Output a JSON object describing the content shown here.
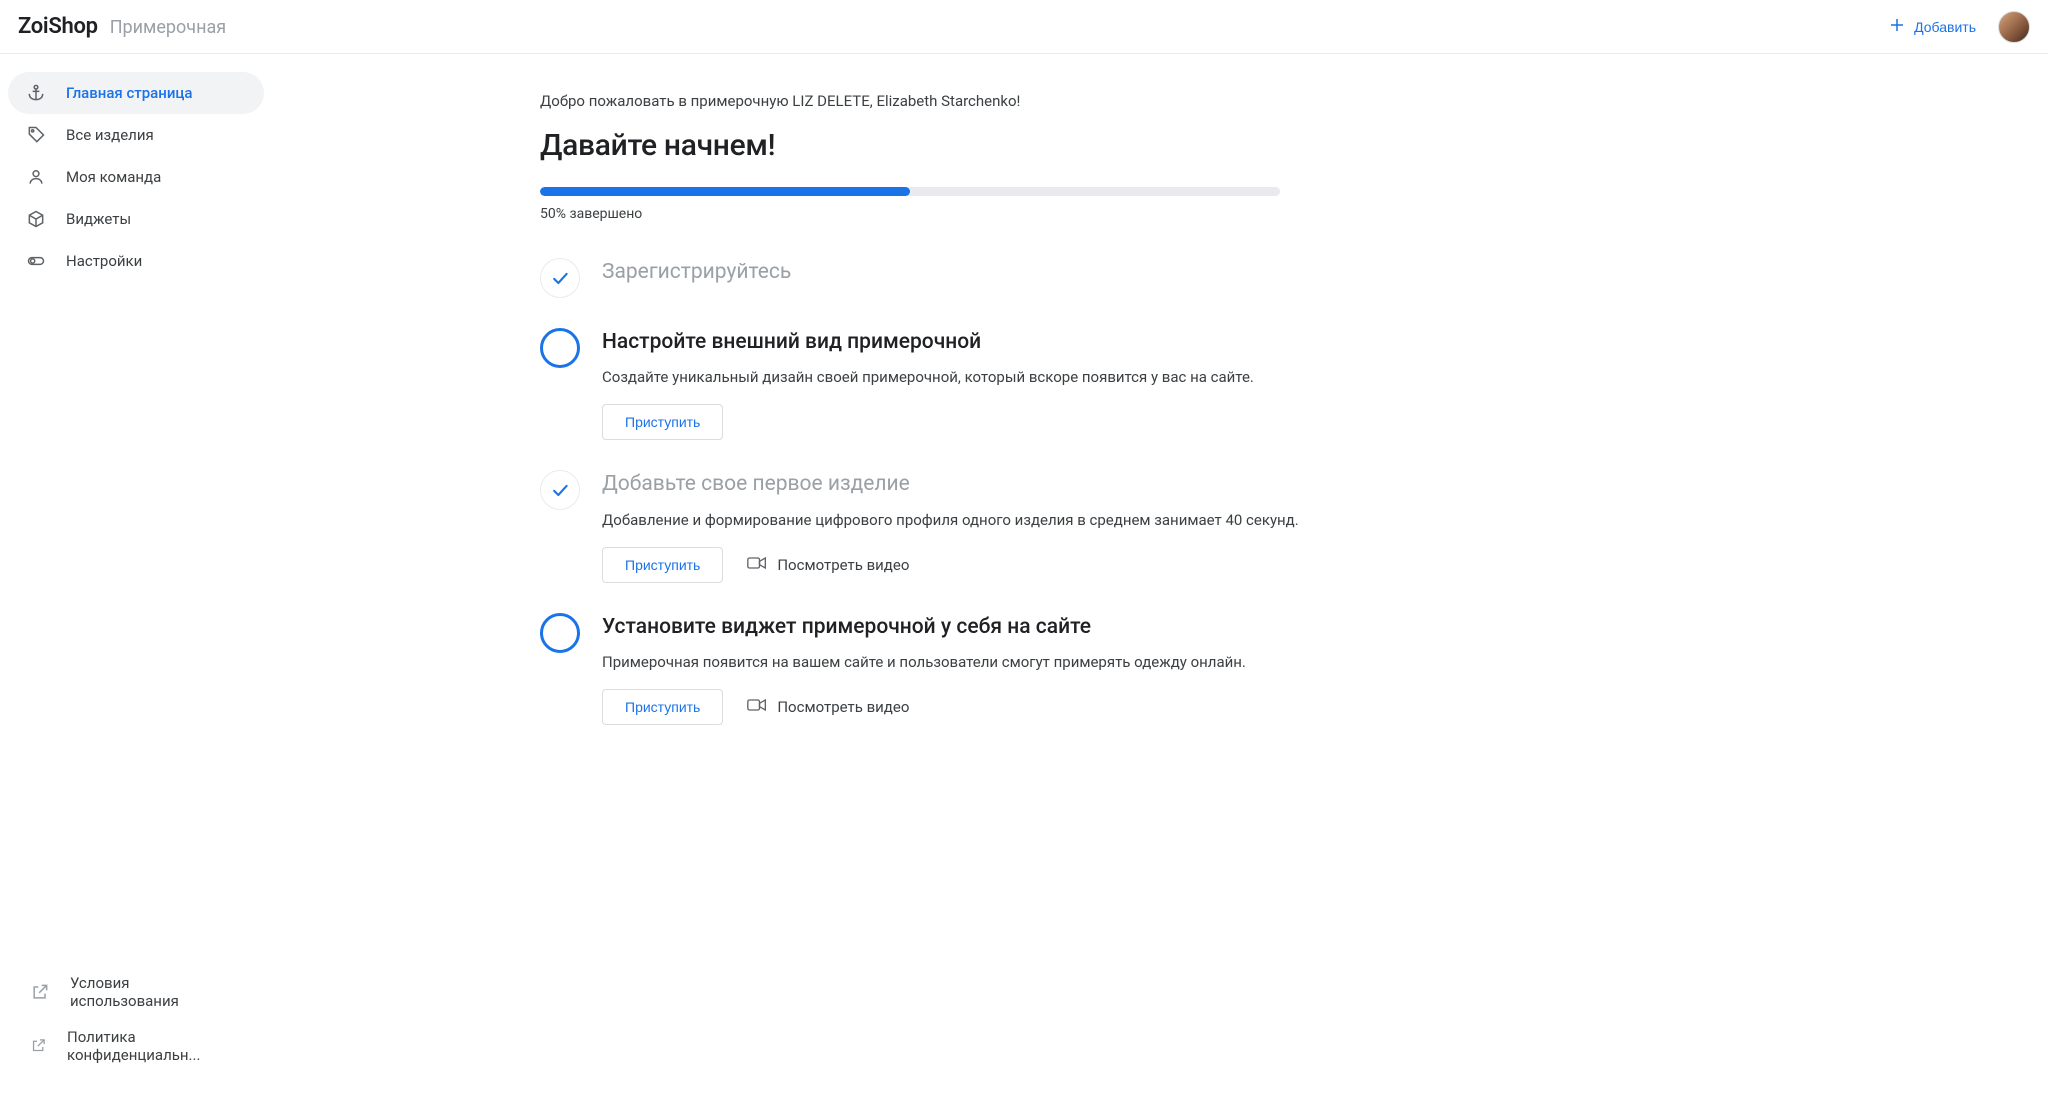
{
  "header": {
    "brand": "ZoiShop",
    "section": "Примерочная",
    "add_label": "Добавить"
  },
  "sidebar": {
    "items": [
      {
        "label": "Главная страница"
      },
      {
        "label": "Все изделия"
      },
      {
        "label": "Моя команда"
      },
      {
        "label": "Виджеты"
      },
      {
        "label": "Настройки"
      }
    ],
    "footer": [
      {
        "label": "Условия использования"
      },
      {
        "label": "Политика конфиденциальн..."
      }
    ]
  },
  "main": {
    "welcome": "Добро пожаловать в примерочную LIZ DELETE, Elizabeth Starchenko!",
    "title": "Давайте начнем!",
    "progress_percent": 50,
    "progress_label": "50% завершено",
    "watch_video_label": "Посмотреть видео",
    "steps": [
      {
        "status": "done",
        "title": "Зарегистрируйтесь"
      },
      {
        "status": "todo",
        "title": "Настройте внешний вид примерочной",
        "desc": "Создайте уникальный дизайн своей примерочной, который вскоре появится у вас на сайте.",
        "action": "Приступить",
        "has_video": false
      },
      {
        "status": "done",
        "title": "Добавьте свое первое изделие",
        "desc": "Добавление и формирование цифрового профиля одного изделия в среднем занимает 40 секунд.",
        "action": "Приступить",
        "has_video": true
      },
      {
        "status": "todo",
        "title": "Установите виджет примерочной у себя на сайте",
        "desc": "Примерочная появится на вашем сайте и пользователи смогут примерять одежду онлайн.",
        "action": "Приступить",
        "has_video": true
      }
    ]
  },
  "colors": {
    "primary": "#1a73e8",
    "muted": "#9aa0a6"
  }
}
